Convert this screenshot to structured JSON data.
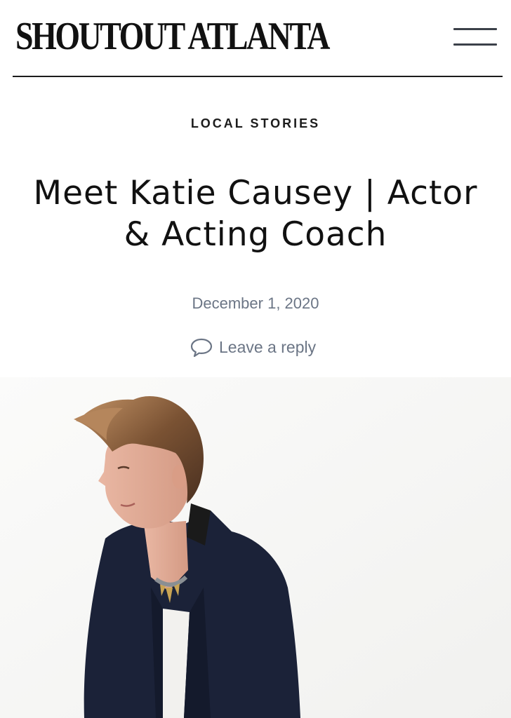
{
  "header": {
    "site_title": "SHOUTOUT ATLANTA",
    "menu_icon": "hamburger-menu-icon"
  },
  "article": {
    "category": "LOCAL STORIES",
    "title": "Meet Katie Causey | Actor & Acting Coach",
    "date": "December 1, 2020",
    "reply_label": "Leave a reply",
    "reply_icon": "comment-bubble-icon",
    "featured_image": "portrait photo of woman with short hair in navy blazer"
  },
  "colors": {
    "text": "#111111",
    "meta": "#6b7585",
    "divider": "#1b1b1b",
    "menu_bars": "#3b4049"
  }
}
